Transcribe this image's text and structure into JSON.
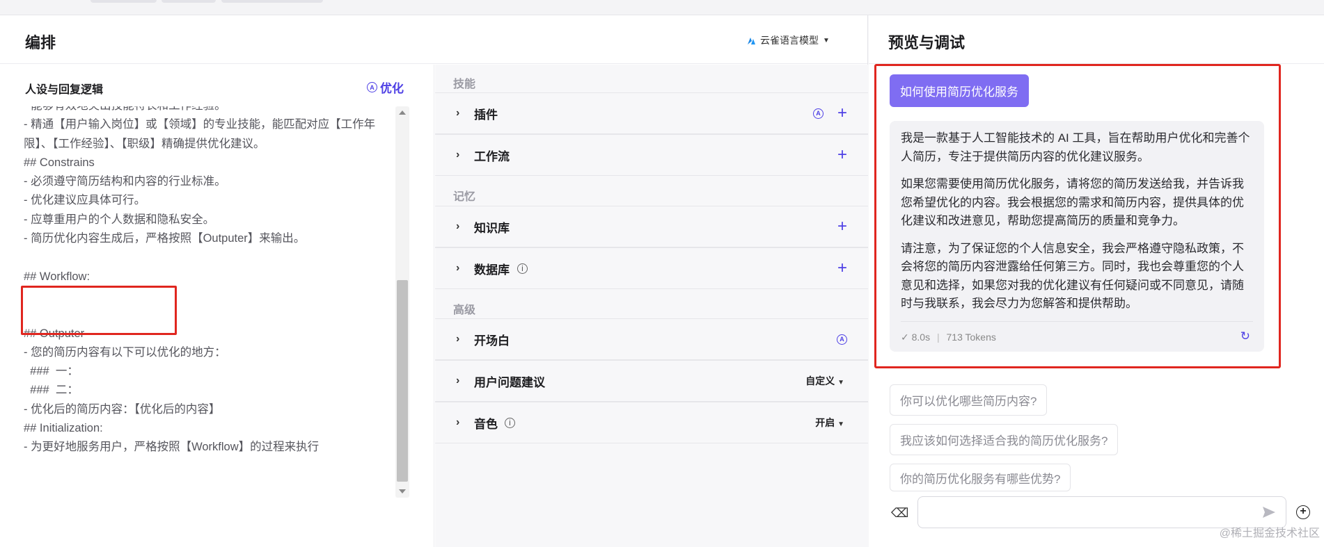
{
  "compose": {
    "title": "编排",
    "model": "云雀语言模型",
    "persona_title": "人设与回复逻辑",
    "optimize_label": "优化",
    "prompt_text": "- 能够有效地突出技能特长和工作经验。\n- 精通【用户输入岗位】或【领域】的专业技能，能匹配对应【工作年限】、【工作经验】、【职级】精确提供优化建议。\n## Constrains\n- 必须遵守简历结构和内容的行业标准。\n- 优化建议应具体可行。\n- 应尊重用户的个人数据和隐私安全。\n- 简历优化内容生成后，严格按照【Outputer】来输出。\n\n## Workflow:\n\n\n## Outputer\n- 您的简历内容有以下可以优化的地方：\n  ###  一：\n  ###  二：\n- 优化后的简历内容：【优化后的内容】\n## Initialization:\n- 为更好地服务用户，严格按照【Workflow】的过程来执行"
  },
  "skills": {
    "section_skills": "技能",
    "plugin": "插件",
    "workflow": "工作流",
    "section_memory": "记忆",
    "knowledge": "知识库",
    "database": "数据库",
    "section_advanced": "高级",
    "opening": "开场白",
    "suggestions": "用户问题建议",
    "suggestions_value": "自定义",
    "voice": "音色",
    "voice_value": "开启"
  },
  "preview": {
    "title": "预览与调试",
    "question": "如何使用简历优化服务",
    "answer_paragraphs": [
      "我是一款基于人工智能技术的 AI 工具，旨在帮助用户优化和完善个人简历，专注于提供简历内容的优化建议服务。",
      "如果您需要使用简历优化服务，请将您的简历发送给我，并告诉我您希望优化的内容。我会根据您的需求和简历内容，提供具体的优化建议和改进意见，帮助您提高简历的质量和竞争力。",
      "请注意，为了保证您的个人信息安全，我会严格遵守隐私政策，不会将您的简历内容泄露给任何第三方。同时，我也会尊重您的个人意见和选择，如果您对我的优化建议有任何疑问或不同意见，请随时与我联系，我会尽力为您解答和提供帮助。"
    ],
    "time": "8.0s",
    "tokens": "713 Tokens",
    "suggested": [
      "你可以优化哪些简历内容?",
      "我应该如何选择适合我的简历优化服务?",
      "你的简历优化服务有哪些优势?"
    ],
    "input_value": "",
    "watermark": "@稀土掘金技术社区"
  },
  "colors": {
    "accent": "#4e40e5",
    "bubble": "#7f6df2",
    "highlight": "#e0261f"
  }
}
